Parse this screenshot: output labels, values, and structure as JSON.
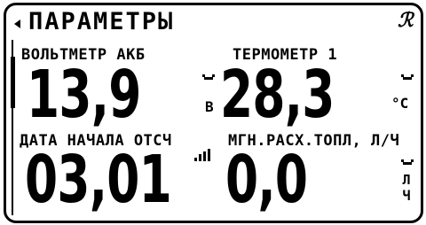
{
  "header": {
    "title": "ПАРАМЕТРЫ",
    "status_icon": "ℛ"
  },
  "cells": [
    {
      "label": "ВОЛЬТМЕТР АКБ",
      "value": "13,9",
      "unit": "В"
    },
    {
      "label": "ТЕРМОМЕТР 1",
      "value": "28,3",
      "unit": "°C"
    },
    {
      "label": "ДАТА НАЧАЛА ОТСЧ",
      "value": "03,01",
      "unit": ""
    },
    {
      "label": "МГН.РАСХ.ТОПЛ, Л/Ч",
      "value": "0,0",
      "unit_top": "Л",
      "unit_bottom": "Ч"
    }
  ],
  "icons": {
    "back": "back-arrow-icon",
    "status": "script-icon",
    "sensor": "cloud-icon",
    "signal": "signal-strength-icon"
  }
}
